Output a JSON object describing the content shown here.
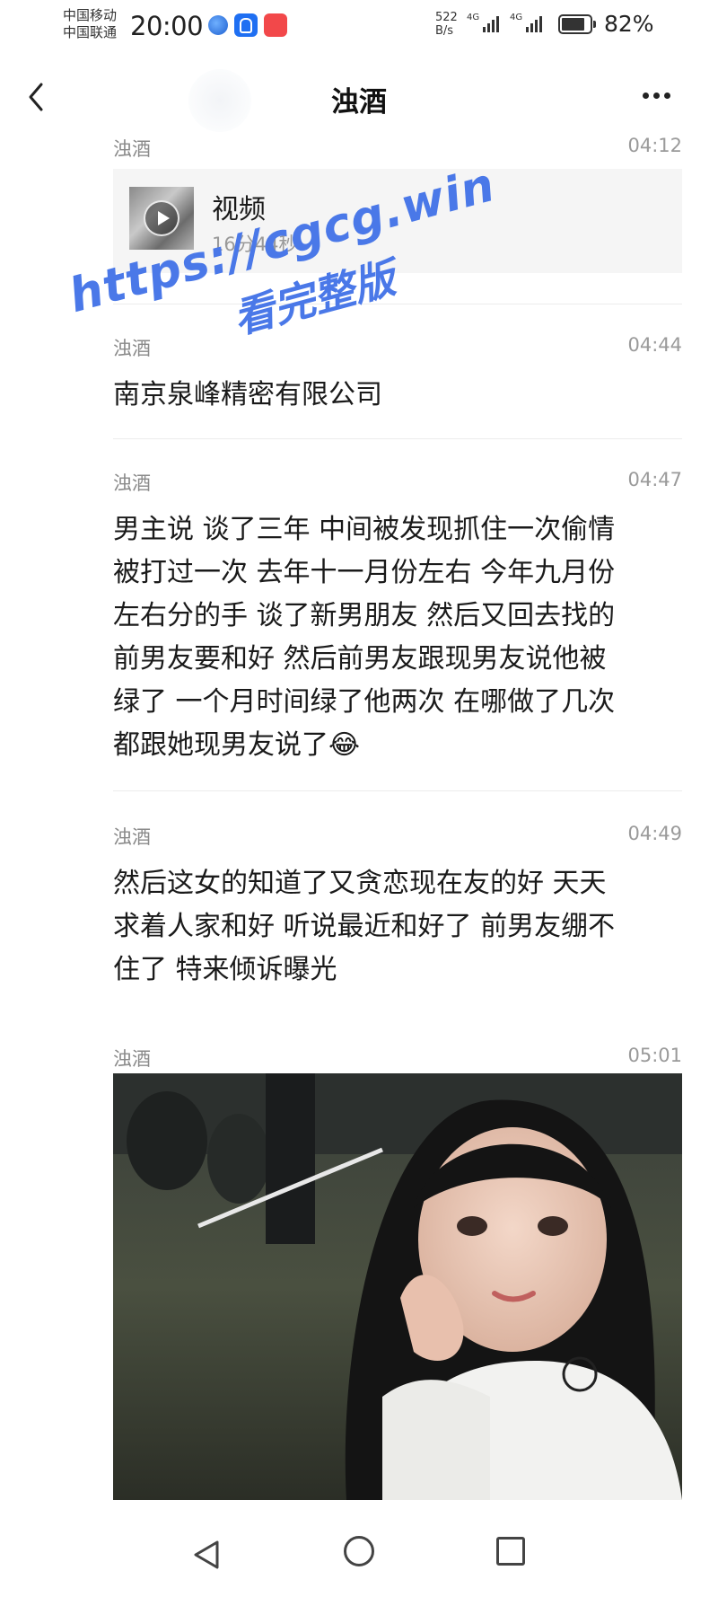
{
  "status_bar": {
    "carrier_1": "中国移动",
    "carrier_2": "中国联通",
    "time": "20:00",
    "net_speed_value": "522",
    "net_speed_unit": "B/s",
    "signal_1_label": "4G",
    "signal_2_label": "4G",
    "battery_percent": "82%",
    "battery_level": 0.82,
    "app_icons": [
      "globe-app-icon",
      "bulb-app-icon",
      "red-app-icon"
    ]
  },
  "nav": {
    "title": "浊酒",
    "back_icon": "chevron-left-icon",
    "more_icon": "more-dots-icon"
  },
  "messages": [
    {
      "sender": "浊酒",
      "time": "04:12",
      "type": "video",
      "video_title": "视频",
      "video_duration": "16分44秒"
    },
    {
      "sender": "浊酒",
      "time": "04:44",
      "text": "南京泉峰精密有限公司"
    },
    {
      "sender": "浊酒",
      "time": "04:47",
      "lines": [
        "男主说 谈了三年 中间被发现抓住一次偷情",
        "被打过一次 去年十一月份左右 今年九月份",
        "左右分的手 谈了新男朋友 然后又回去找的",
        "前男友要和好  然后前男友跟现男友说他被",
        "绿了  一个月时间绿了他两次 在哪做了几次",
        "都跟她现男友说了😂"
      ]
    },
    {
      "sender": "浊酒",
      "time": "04:49",
      "lines": [
        "然后这女的知道了又贪恋现在友的好 天天",
        "求着人家和好 听说最近和好了  前男友绷不",
        "住了 特来倾诉曝光"
      ]
    },
    {
      "sender": "浊酒",
      "time": "05:01",
      "type": "image"
    }
  ],
  "watermark": {
    "url": "https://cgcg.win",
    "subtitle": "看完整版"
  },
  "system_nav": {
    "back_icon": "triangle-back-icon",
    "home_icon": "circle-home-icon",
    "recent_icon": "square-recent-icon"
  }
}
